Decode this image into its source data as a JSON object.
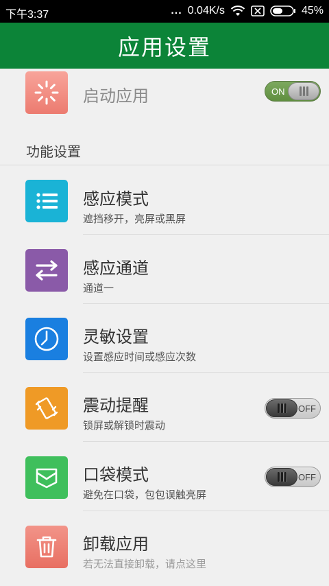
{
  "status_bar": {
    "time": "下午3:37",
    "network_speed": "0.04K/s",
    "battery": "45%",
    "icons": [
      "wifi-icon",
      "sim-disabled-icon",
      "battery-icon"
    ]
  },
  "app_bar": {
    "title": "应用设置"
  },
  "launch": {
    "label": "启动应用",
    "toggle_label": "ON",
    "enabled": true
  },
  "section": {
    "title": "功能设置"
  },
  "items": [
    {
      "title": "感应模式",
      "subtitle": "遮挡移开，亮屏或黑屏",
      "icon": "list-icon",
      "color": "#1ab3d6"
    },
    {
      "title": "感应通道",
      "subtitle": "通道一",
      "icon": "swap-arrows-icon",
      "color": "#8a5aa8"
    },
    {
      "title": "灵敏设置",
      "subtitle": "设置感应时间或感应次数",
      "icon": "clock-icon",
      "color": "#1a7fe0"
    },
    {
      "title": "震动提醒",
      "subtitle": "锁屏或解锁时震动",
      "icon": "vibrate-icon",
      "color": "#ef9a26",
      "toggle_label": "OFF",
      "enabled": false
    },
    {
      "title": "口袋模式",
      "subtitle": "避免在口袋，包包误触亮屏",
      "icon": "pocket-icon",
      "color": "#3fbf5c",
      "toggle_label": "OFF",
      "enabled": false
    },
    {
      "title": "卸载应用",
      "subtitle": "若无法直接卸载，请点这里",
      "icon": "trash-icon",
      "color": "#ef8274"
    }
  ],
  "colors": {
    "app_bar": "#0c8438",
    "background": "#f0f0f0"
  }
}
